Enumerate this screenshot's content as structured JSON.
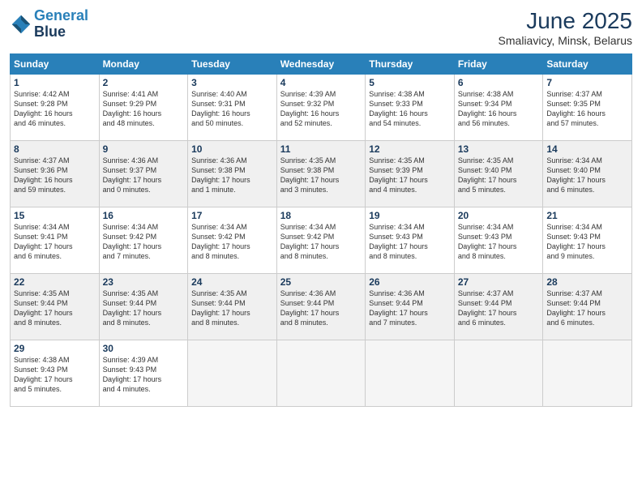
{
  "logo": {
    "line1": "General",
    "line2": "Blue"
  },
  "title": "June 2025",
  "subtitle": "Smaliavicy, Minsk, Belarus",
  "weekdays": [
    "Sunday",
    "Monday",
    "Tuesday",
    "Wednesday",
    "Thursday",
    "Friday",
    "Saturday"
  ],
  "weeks": [
    [
      {
        "day": 1,
        "info": "Sunrise: 4:42 AM\nSunset: 9:28 PM\nDaylight: 16 hours\nand 46 minutes."
      },
      {
        "day": 2,
        "info": "Sunrise: 4:41 AM\nSunset: 9:29 PM\nDaylight: 16 hours\nand 48 minutes."
      },
      {
        "day": 3,
        "info": "Sunrise: 4:40 AM\nSunset: 9:31 PM\nDaylight: 16 hours\nand 50 minutes."
      },
      {
        "day": 4,
        "info": "Sunrise: 4:39 AM\nSunset: 9:32 PM\nDaylight: 16 hours\nand 52 minutes."
      },
      {
        "day": 5,
        "info": "Sunrise: 4:38 AM\nSunset: 9:33 PM\nDaylight: 16 hours\nand 54 minutes."
      },
      {
        "day": 6,
        "info": "Sunrise: 4:38 AM\nSunset: 9:34 PM\nDaylight: 16 hours\nand 56 minutes."
      },
      {
        "day": 7,
        "info": "Sunrise: 4:37 AM\nSunset: 9:35 PM\nDaylight: 16 hours\nand 57 minutes."
      }
    ],
    [
      {
        "day": 8,
        "info": "Sunrise: 4:37 AM\nSunset: 9:36 PM\nDaylight: 16 hours\nand 59 minutes."
      },
      {
        "day": 9,
        "info": "Sunrise: 4:36 AM\nSunset: 9:37 PM\nDaylight: 17 hours\nand 0 minutes."
      },
      {
        "day": 10,
        "info": "Sunrise: 4:36 AM\nSunset: 9:38 PM\nDaylight: 17 hours\nand 1 minute."
      },
      {
        "day": 11,
        "info": "Sunrise: 4:35 AM\nSunset: 9:38 PM\nDaylight: 17 hours\nand 3 minutes."
      },
      {
        "day": 12,
        "info": "Sunrise: 4:35 AM\nSunset: 9:39 PM\nDaylight: 17 hours\nand 4 minutes."
      },
      {
        "day": 13,
        "info": "Sunrise: 4:35 AM\nSunset: 9:40 PM\nDaylight: 17 hours\nand 5 minutes."
      },
      {
        "day": 14,
        "info": "Sunrise: 4:34 AM\nSunset: 9:40 PM\nDaylight: 17 hours\nand 6 minutes."
      }
    ],
    [
      {
        "day": 15,
        "info": "Sunrise: 4:34 AM\nSunset: 9:41 PM\nDaylight: 17 hours\nand 6 minutes."
      },
      {
        "day": 16,
        "info": "Sunrise: 4:34 AM\nSunset: 9:42 PM\nDaylight: 17 hours\nand 7 minutes."
      },
      {
        "day": 17,
        "info": "Sunrise: 4:34 AM\nSunset: 9:42 PM\nDaylight: 17 hours\nand 8 minutes."
      },
      {
        "day": 18,
        "info": "Sunrise: 4:34 AM\nSunset: 9:42 PM\nDaylight: 17 hours\nand 8 minutes."
      },
      {
        "day": 19,
        "info": "Sunrise: 4:34 AM\nSunset: 9:43 PM\nDaylight: 17 hours\nand 8 minutes."
      },
      {
        "day": 20,
        "info": "Sunrise: 4:34 AM\nSunset: 9:43 PM\nDaylight: 17 hours\nand 8 minutes."
      },
      {
        "day": 21,
        "info": "Sunrise: 4:34 AM\nSunset: 9:43 PM\nDaylight: 17 hours\nand 9 minutes."
      }
    ],
    [
      {
        "day": 22,
        "info": "Sunrise: 4:35 AM\nSunset: 9:44 PM\nDaylight: 17 hours\nand 8 minutes."
      },
      {
        "day": 23,
        "info": "Sunrise: 4:35 AM\nSunset: 9:44 PM\nDaylight: 17 hours\nand 8 minutes."
      },
      {
        "day": 24,
        "info": "Sunrise: 4:35 AM\nSunset: 9:44 PM\nDaylight: 17 hours\nand 8 minutes."
      },
      {
        "day": 25,
        "info": "Sunrise: 4:36 AM\nSunset: 9:44 PM\nDaylight: 17 hours\nand 8 minutes."
      },
      {
        "day": 26,
        "info": "Sunrise: 4:36 AM\nSunset: 9:44 PM\nDaylight: 17 hours\nand 7 minutes."
      },
      {
        "day": 27,
        "info": "Sunrise: 4:37 AM\nSunset: 9:44 PM\nDaylight: 17 hours\nand 6 minutes."
      },
      {
        "day": 28,
        "info": "Sunrise: 4:37 AM\nSunset: 9:44 PM\nDaylight: 17 hours\nand 6 minutes."
      }
    ],
    [
      {
        "day": 29,
        "info": "Sunrise: 4:38 AM\nSunset: 9:43 PM\nDaylight: 17 hours\nand 5 minutes."
      },
      {
        "day": 30,
        "info": "Sunrise: 4:39 AM\nSunset: 9:43 PM\nDaylight: 17 hours\nand 4 minutes."
      },
      null,
      null,
      null,
      null,
      null
    ]
  ]
}
